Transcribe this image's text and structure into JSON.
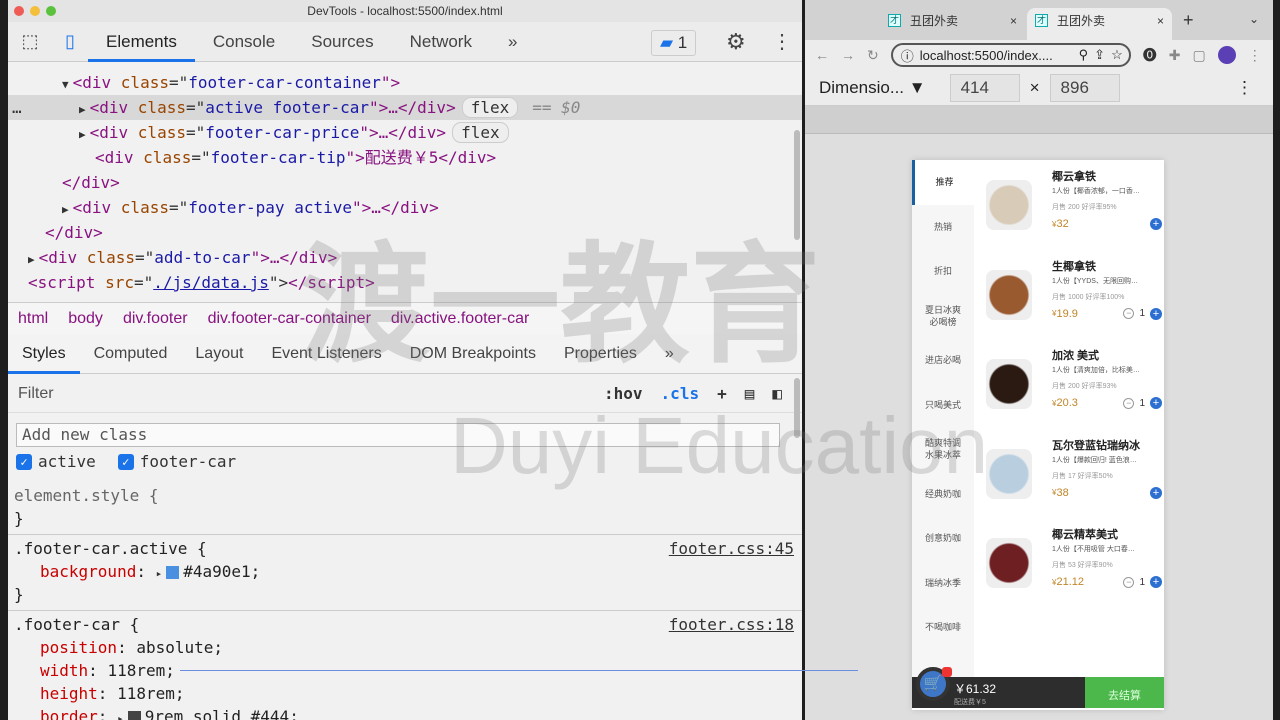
{
  "window_title": "DevTools - localhost:5500/index.html",
  "devtools": {
    "tabs": [
      "Elements",
      "Console",
      "Sources",
      "Network"
    ],
    "more": "»",
    "issues_count": "1",
    "dom": [
      {
        "indent": 0,
        "arrow": "▼",
        "tag": "div",
        "cls": "footer-car-container",
        "end": ""
      },
      {
        "indent": 1,
        "arrow": "▶",
        "tag": "div",
        "cls": "active footer-car",
        "end": "…</div>",
        "badge": "flex",
        "marker": "== $0"
      },
      {
        "indent": 1,
        "arrow": "▶",
        "tag": "div",
        "cls": "footer-car-price",
        "end": "…</div>",
        "badge": "flex"
      },
      {
        "indent": 1,
        "arrow": "",
        "tag": "div",
        "cls": "footer-car-tip",
        "end": "配送费￥5</div>"
      },
      {
        "indent": 0,
        "close": "</div>"
      },
      {
        "indent": 0,
        "arrow": "▶",
        "tag": "div",
        "cls": "footer-pay active",
        "end": "…</div>"
      },
      {
        "indent": -1,
        "close": "</div>"
      },
      {
        "indent": -2,
        "arrow": "▶",
        "tag": "div",
        "cls": "add-to-car",
        "end": "…</div>"
      },
      {
        "indent": -2,
        "script": "./js/data.js"
      }
    ],
    "breadcrumbs": [
      "html",
      "body",
      "div.footer",
      "div.footer-car-container",
      "div.active.footer-car"
    ],
    "subtabs": [
      "Styles",
      "Computed",
      "Layout",
      "Event Listeners",
      "DOM Breakpoints",
      "Properties"
    ],
    "filter_placeholder": "Filter",
    "hov": ":hov",
    "cls": ".cls",
    "plus": "+",
    "add_class_placeholder": "Add new class",
    "classes": [
      "active",
      "footer-car"
    ],
    "element_style": "element.style {",
    "close_brace": "}",
    "rules": [
      {
        "selector": ".footer-car.active {",
        "source": "footer.css:45",
        "props": [
          {
            "name": "background",
            "value": "#4a90e1",
            "swatch": "#4a90e1"
          }
        ]
      },
      {
        "selector": ".footer-car {",
        "source": "footer.css:18",
        "props": [
          {
            "name": "position",
            "value": "absolute"
          },
          {
            "name": "width",
            "value": "118rem"
          },
          {
            "name": "height",
            "value": "118rem"
          },
          {
            "name": "border",
            "value": "9rem solid #444",
            "swatch": "#444444"
          }
        ]
      }
    ]
  },
  "browser": {
    "tabs": [
      "丑团外卖",
      "丑团外卖"
    ],
    "url": "localhost:5500/index....",
    "device": "Dimensio...",
    "width": "414",
    "height": "896",
    "categories": [
      "推荐",
      "热销",
      "折扣",
      "夏日冰爽\n必喝榜",
      "进店必喝",
      "只喝美式",
      "酷爽特调\n水果冰萃",
      "经典奶咖",
      "创意奶咖",
      "瑞纳冰季",
      "不喝咖啡"
    ],
    "products": [
      {
        "name": "椰云拿铁",
        "desc": "1人份【椰香浓郁，一口香…",
        "sales": "月售 200  好评率95%",
        "price": "32",
        "qty": ""
      },
      {
        "name": "生椰拿铁",
        "desc": "1人份【YYDS、无限回购…",
        "sales": "月售 1000  好评率100%",
        "price": "19.9",
        "qty": "1"
      },
      {
        "name": "加浓 美式",
        "desc": "1人份【清爽加倍，比标美…",
        "sales": "月售 200  好评率93%",
        "price": "20.3",
        "qty": "1"
      },
      {
        "name": "瓦尔登蓝钻瑞纳冰",
        "desc": "1人份【爆款回归! 蓝色浪…",
        "sales": "月售 17  好评率50%",
        "price": "38",
        "qty": ""
      },
      {
        "name": "椰云精萃美式",
        "desc": "1人份【不用吸管 大口春…",
        "sales": "月售 53  好评率90%",
        "price": "21.12",
        "qty": "1"
      }
    ],
    "total": "￥61.32",
    "delivery": "配送费￥5",
    "pay": "去结算",
    "colors": {
      "accent": "#4a90e1",
      "pay": "#4cb84c"
    }
  },
  "watermark": {
    "cn": "渡一教育",
    "en": "Duyi Education"
  }
}
